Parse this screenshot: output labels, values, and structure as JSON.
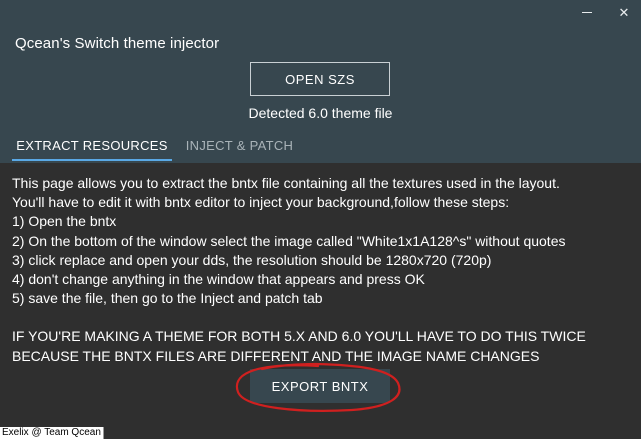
{
  "window": {
    "minimize_glyph": "",
    "close_glyph": "✕"
  },
  "app": {
    "title": "Qcean's Switch theme injector",
    "open_button": "OPEN SZS",
    "status": "Detected 6.0 theme file"
  },
  "tabs": [
    {
      "label": "EXTRACT RESOURCES",
      "active": true
    },
    {
      "label": "INJECT & PATCH",
      "active": false
    }
  ],
  "content": {
    "lines": [
      "This page allows you to extract the bntx file containing all the textures used in the layout.",
      "You'll have to edit it with bntx editor to inject your background,follow these steps:",
      "1) Open the bntx",
      "2) On the bottom of the window select the image called \"White1x1A128^s\" without quotes",
      "3) click replace and open your dds, the resolution should be 1280x720 (720p)",
      "4) don't change anything in the window that appears and press OK",
      "5) save the file, then go to the Inject and patch tab"
    ],
    "warning_lines": [
      "IF YOU'RE MAKING A THEME FOR BOTH 5.X AND 6.0 YOU'LL HAVE TO DO THIS TWICE",
      "BECAUSE THE BNTX FILES ARE DIFFERENT AND THE IMAGE NAME CHANGES"
    ]
  },
  "export_button": "EXPORT BNTX",
  "footer": {
    "credit": "Exelix @ Team Qcean"
  },
  "colors": {
    "header_bg": "#37474f",
    "body_bg": "#2f2f2f",
    "tab_indicator": "#5aa9e6",
    "annotation_red": "#d0201f"
  }
}
